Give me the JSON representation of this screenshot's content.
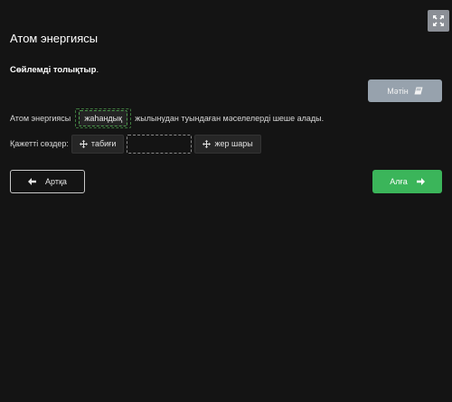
{
  "header": {
    "title": "Атом энергиясы",
    "fullscreen_icon": "expand-arrows-icon"
  },
  "task": {
    "instruction_bold": "Сөйлемді толықтыр",
    "instruction_end": ".",
    "text_button_label": "Мәтін",
    "text_button_icon": "book-icon"
  },
  "sentence": {
    "before": "Атом энергиясы",
    "filled_word": "жаһандық",
    "after": "жылынудан туындаған мәселелерді шеше алады."
  },
  "words": {
    "label": "Қажетті сөздер:",
    "options": [
      "табиғи",
      "жер шары"
    ],
    "drag_icon": "move-arrows-icon"
  },
  "navigation": {
    "back_label": "Артқа",
    "forward_label": "Алға"
  },
  "colors": {
    "background": "#141414",
    "forward_button": "#3bb55a",
    "text_button": "#97a2ad",
    "drop_border": "#4e9c4e"
  }
}
